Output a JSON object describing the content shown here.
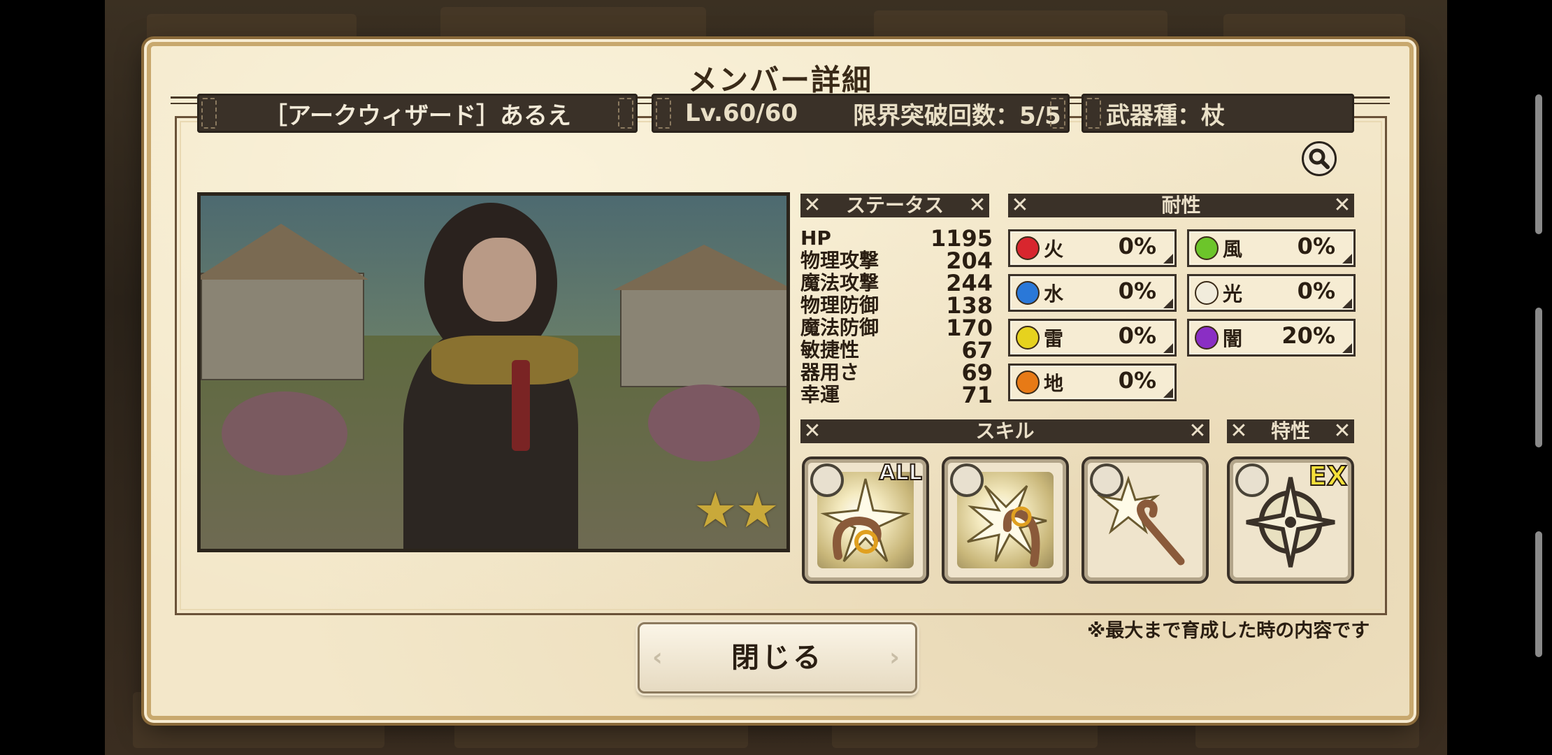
{
  "dialog": {
    "title": "メンバー詳細",
    "note": "※最大まで育成した時の内容です",
    "close_label": "閉じる"
  },
  "header": {
    "name": "［アークウィザード］あるえ",
    "level": "Lv.60/60",
    "limit_break": "限界突破回数：5/5",
    "weapon": "武器種：杖"
  },
  "sections": {
    "status": "ステータス",
    "resistance": "耐性",
    "skill": "スキル",
    "trait": "特性"
  },
  "stats": [
    {
      "name": "HP",
      "value": "1195"
    },
    {
      "name": "物理攻撃",
      "value": "204"
    },
    {
      "name": "魔法攻撃",
      "value": "244"
    },
    {
      "name": "物理防御",
      "value": "138"
    },
    {
      "name": "魔法防御",
      "value": "170"
    },
    {
      "name": "敏捷性",
      "value": "67"
    },
    {
      "name": "器用さ",
      "value": "69"
    },
    {
      "name": "幸運",
      "value": "71"
    }
  ],
  "resistances": [
    {
      "element": "火",
      "value": "0%",
      "color": "#d8262e"
    },
    {
      "element": "風",
      "value": "0%",
      "color": "#6cc52a"
    },
    {
      "element": "水",
      "value": "0%",
      "color": "#2a78d8"
    },
    {
      "element": "光",
      "value": "0%",
      "color": "#f1ecdc"
    },
    {
      "element": "雷",
      "value": "0%",
      "color": "#e6d21e"
    },
    {
      "element": "闇",
      "value": "20%",
      "color": "#8a2ec4"
    },
    {
      "element": "地",
      "value": "0%",
      "color": "#e77a16"
    }
  ],
  "skills": [
    {
      "icon": "staff-burst-icon",
      "tag": "ALL"
    },
    {
      "icon": "staff-shatter-icon",
      "tag": ""
    },
    {
      "icon": "staff-spark-icon",
      "tag": ""
    }
  ],
  "trait": {
    "icon": "compass-star-icon",
    "tag": "EX"
  },
  "rarity_stars": 2
}
